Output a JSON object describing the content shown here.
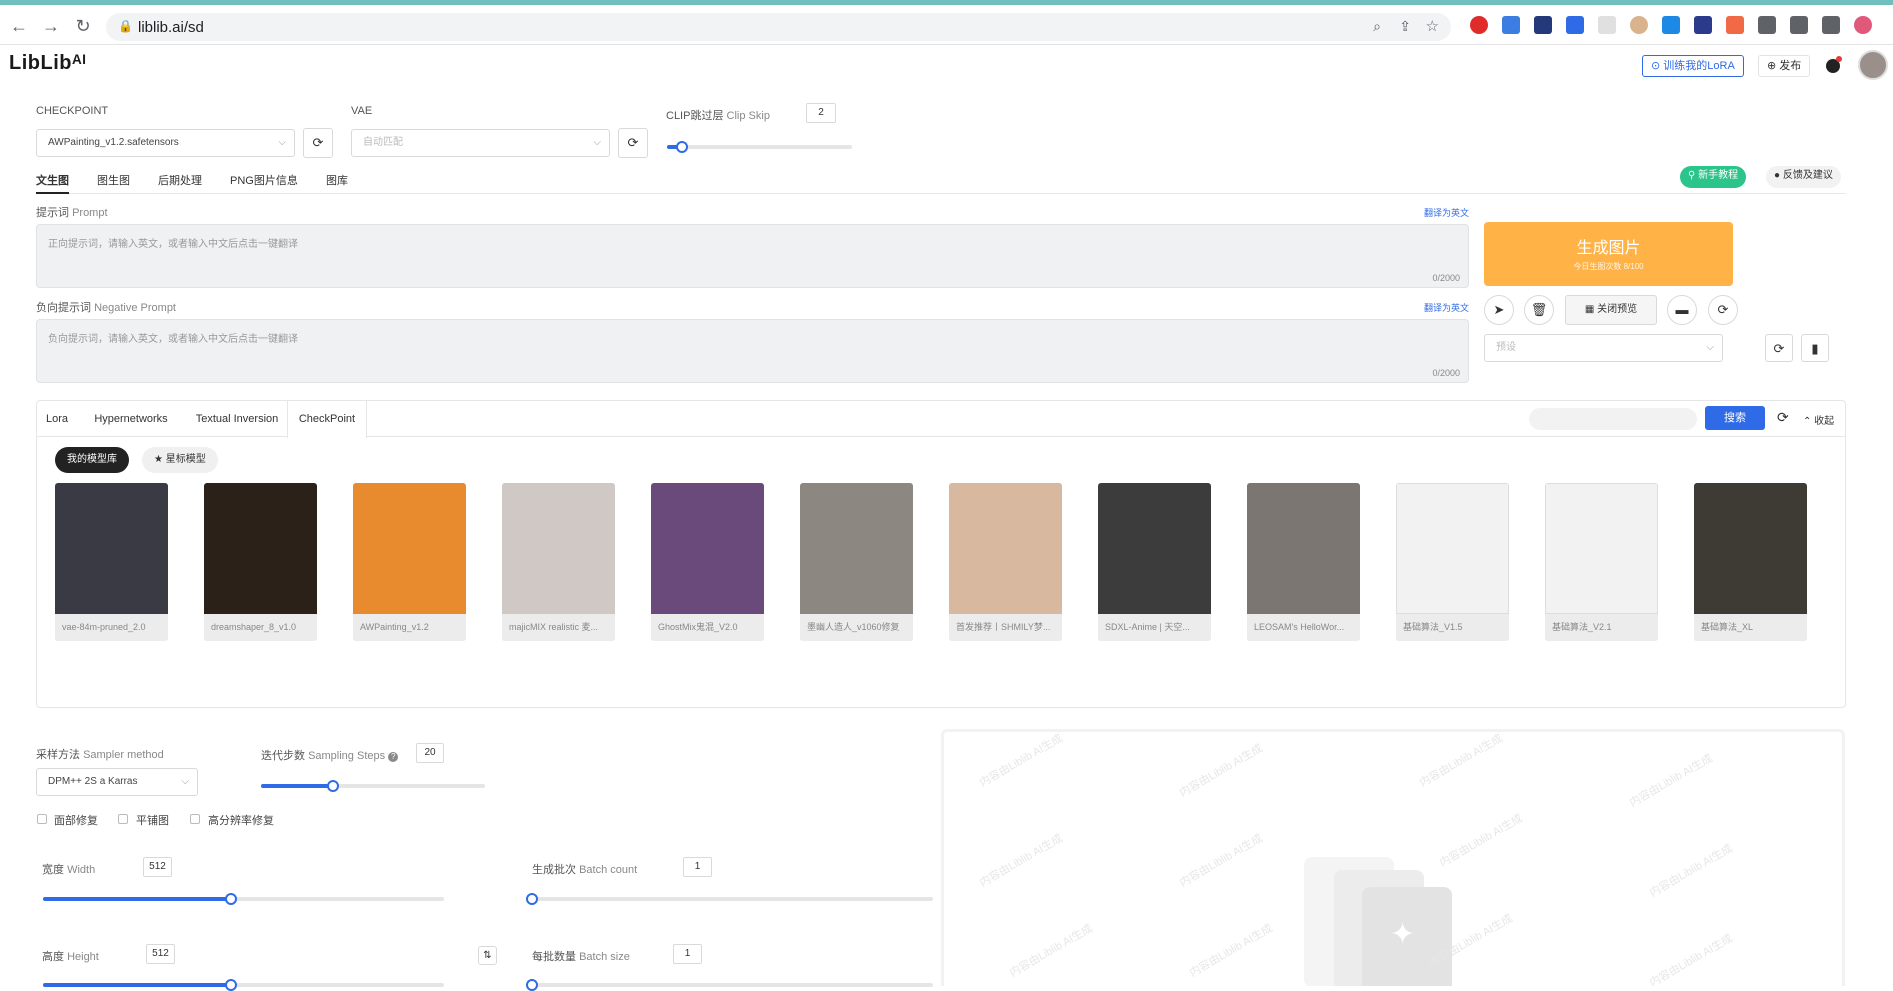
{
  "browser": {
    "url": "liblib.ai/sd",
    "nav": {
      "back": "←",
      "forward": "→",
      "reload": "↻"
    }
  },
  "header": {
    "logo": "LibLibᴬᴵ",
    "train_lora": "⊙ 训练我的LoRA",
    "publish": "⊕ 发布"
  },
  "model_settings": {
    "checkpoint_label": "CHECKPOINT",
    "checkpoint_value": "AWPainting_v1.2.safetensors",
    "vae_label": "VAE",
    "vae_value": "自动匹配",
    "clip_label": "CLIP跳过层",
    "clip_label_en": "Clip Skip",
    "clip_value": "2",
    "clip_slider_fraction": 0.08
  },
  "main_tabs": [
    "文生图",
    "图生图",
    "后期处理",
    "PNG图片信息",
    "图库"
  ],
  "active_main_tab": "文生图",
  "top_right_buttons": {
    "tutorial": "⚲ 新手教程",
    "feedback": "● 反馈及建议"
  },
  "prompt": {
    "label": "提示词",
    "label_en": "Prompt",
    "translate": "翻译为英文",
    "placeholder": "正向提示词，请输入英文，或者输入中文后点击一键翻译",
    "count": "0/2000"
  },
  "negative_prompt": {
    "label": "负向提示词",
    "label_en": "Negative Prompt",
    "translate": "翻译为英文",
    "placeholder": "负向提示词，请输入英文，或者输入中文后点击一键翻译",
    "count": "0/2000"
  },
  "generate": {
    "label": "生成图片",
    "sub": "今日生图次数 8/100",
    "color": "#ffb347"
  },
  "tool_buttons": {
    "close_preview": "关闭预览",
    "preset_placeholder": "预设"
  },
  "model_tabs": [
    "Lora",
    "Hypernetworks",
    "Textual Inversion",
    "CheckPoint"
  ],
  "active_model_tab": "CheckPoint",
  "search_button": "搜索",
  "collapse": "⌃ 收起",
  "library_buttons": {
    "mine": "我的模型库",
    "starred": "★ 星标模型"
  },
  "model_cards": [
    {
      "name": "vae-84m-pruned_2.0",
      "color": "#3a3a44"
    },
    {
      "name": "dreamshaper_8_v1.0",
      "color": "#2b2118"
    },
    {
      "name": "AWPainting_v1.2",
      "color": "#e88a2e"
    },
    {
      "name": "majicMIX realistic 麦...",
      "color": "#cfc8c4"
    },
    {
      "name": "GhostMix鬼混_V2.0",
      "color": "#6a4a7a"
    },
    {
      "name": "墨幽人造人_v1060修复",
      "color": "#8c8780"
    },
    {
      "name": "首发推荐丨SHMILY梦...",
      "color": "#d8b9a0"
    },
    {
      "name": "SDXL-Anime | 天空...",
      "color": "#3c3c3c"
    },
    {
      "name": "LEOSAM's HelloWor...",
      "color": "#7c7672"
    },
    {
      "name": "基础算法_V1.5",
      "color": "#f2f2f2"
    },
    {
      "name": "基础算法_V2.1",
      "color": "#f2f2f2"
    },
    {
      "name": "基础算法_XL",
      "color": "#3d3b34"
    }
  ],
  "sampler": {
    "label": "采样方法",
    "label_en": "Sampler method",
    "value": "DPM++ 2S a Karras"
  },
  "steps": {
    "label": "迭代步数",
    "label_en": "Sampling Steps",
    "value": "20",
    "fraction": 0.32
  },
  "checkboxes": [
    "面部修复",
    "平铺图",
    "高分辨率修复"
  ],
  "width": {
    "label": "宽度",
    "label_en": "Width",
    "value": "512",
    "fraction": 0.47
  },
  "height": {
    "label": "高度",
    "label_en": "Height",
    "value": "512",
    "fraction": 0.47
  },
  "batch_count": {
    "label": "生成批次",
    "label_en": "Batch count",
    "value": "1",
    "fraction": 0.0
  },
  "batch_size": {
    "label": "每批数量",
    "label_en": "Batch size",
    "value": "1",
    "fraction": 0.0
  },
  "watermark": "内容由Liblib AI生成"
}
